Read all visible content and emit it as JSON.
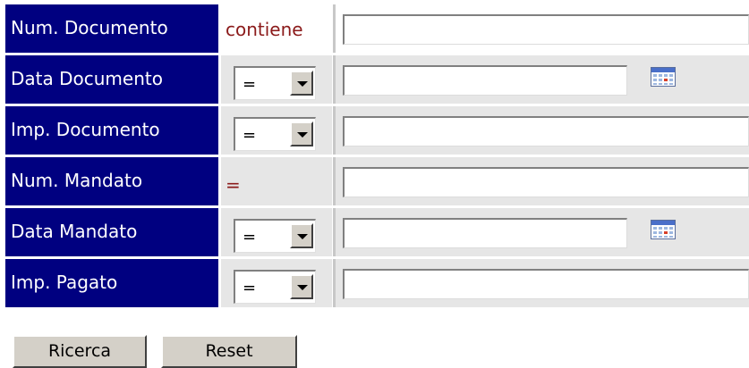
{
  "form": {
    "rows": [
      {
        "label": "Num. Documento",
        "operator_text": "contiene",
        "value": ""
      },
      {
        "label": "Data Documento",
        "operator_selected": "=",
        "value": "",
        "icon": "calendar-icon"
      },
      {
        "label": "Imp. Documento",
        "operator_selected": "=",
        "value": ""
      },
      {
        "label": "Num. Mandato",
        "operator_text": "=",
        "value": ""
      },
      {
        "label": "Data Mandato",
        "operator_selected": "=",
        "value": "",
        "icon": "calendar-icon"
      },
      {
        "label": "Imp. Pagato",
        "operator_selected": "=",
        "value": ""
      }
    ]
  },
  "buttons": {
    "search_label": "Ricerca",
    "reset_label": "Reset"
  },
  "colors": {
    "label_background": "#000080",
    "label_text": "#ffffff",
    "operator_text": "#8b1a1a",
    "cell_background": "#e6e6e6"
  }
}
